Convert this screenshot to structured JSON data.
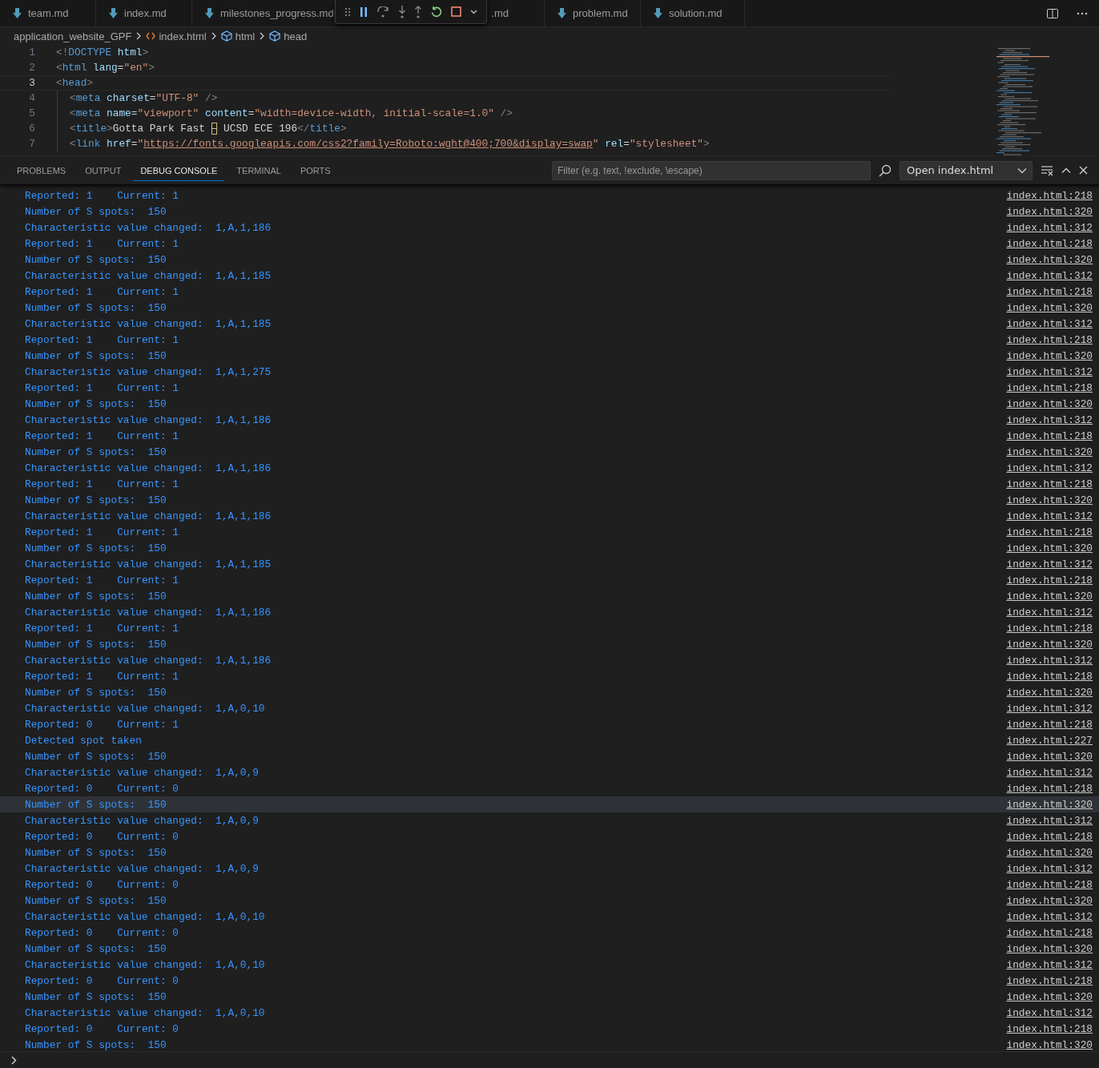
{
  "editor_tabs": [
    {
      "label": "team.md"
    },
    {
      "label": "index.md"
    },
    {
      "label": "milestones_progress.md"
    },
    {
      "label": ".md"
    },
    {
      "label": "problem.md"
    },
    {
      "label": "solution.md"
    }
  ],
  "breadcrumb": [
    {
      "label": "application_website_GPF",
      "kind": "folder"
    },
    {
      "label": "index.html",
      "kind": "file"
    },
    {
      "label": "html",
      "kind": "element"
    },
    {
      "label": "head",
      "kind": "element"
    }
  ],
  "code_lines": [
    {
      "number": "1",
      "selected": false,
      "indented": false,
      "tokens": [
        {
          "text": "<!",
          "kind": "punct"
        },
        {
          "text": "DOCTYPE",
          "kind": "tag"
        },
        {
          "text": " html",
          "kind": "attr"
        },
        {
          "text": ">",
          "kind": "punct"
        }
      ]
    },
    {
      "number": "2",
      "selected": false,
      "indented": false,
      "tokens": [
        {
          "text": "<",
          "kind": "punct"
        },
        {
          "text": "html",
          "kind": "tag"
        },
        {
          "text": " lang",
          "kind": "attr"
        },
        {
          "text": "=",
          "kind": "text"
        },
        {
          "text": "\"en\"",
          "kind": "str"
        },
        {
          "text": ">",
          "kind": "punct"
        }
      ]
    },
    {
      "number": "3",
      "selected": true,
      "indented": false,
      "tokens": [
        {
          "text": "<",
          "kind": "punct"
        },
        {
          "text": "head",
          "kind": "tag"
        },
        {
          "text": ">",
          "kind": "punct"
        }
      ]
    },
    {
      "number": "4",
      "selected": false,
      "indented": true,
      "tokens": [
        {
          "text": "<",
          "kind": "punct"
        },
        {
          "text": "meta",
          "kind": "tag"
        },
        {
          "text": " charset",
          "kind": "attr"
        },
        {
          "text": "=",
          "kind": "text"
        },
        {
          "text": "\"UTF-8\"",
          "kind": "str"
        },
        {
          "text": " />",
          "kind": "punct"
        }
      ]
    },
    {
      "number": "5",
      "selected": false,
      "indented": true,
      "tokens": [
        {
          "text": "<",
          "kind": "punct"
        },
        {
          "text": "meta",
          "kind": "tag"
        },
        {
          "text": " name",
          "kind": "attr"
        },
        {
          "text": "=",
          "kind": "text"
        },
        {
          "text": "\"viewport\"",
          "kind": "str"
        },
        {
          "text": " content",
          "kind": "attr"
        },
        {
          "text": "=",
          "kind": "text"
        },
        {
          "text": "\"width=device-width, initial-scale=1.0\"",
          "kind": "str"
        },
        {
          "text": " />",
          "kind": "punct"
        }
      ]
    },
    {
      "number": "6",
      "selected": false,
      "indented": true,
      "tokens": [
        {
          "text": "<",
          "kind": "punct"
        },
        {
          "text": "title",
          "kind": "tag"
        },
        {
          "text": ">",
          "kind": "punct"
        },
        {
          "text": "Gotta Park Fast ",
          "kind": "text"
        },
        {
          "text": "–",
          "kind": "flagged"
        },
        {
          "text": " UCSD ECE 196",
          "kind": "text"
        },
        {
          "text": "</",
          "kind": "punct"
        },
        {
          "text": "title",
          "kind": "tag"
        },
        {
          "text": ">",
          "kind": "punct"
        }
      ]
    },
    {
      "number": "7",
      "selected": false,
      "indented": true,
      "tokens": [
        {
          "text": "<",
          "kind": "punct"
        },
        {
          "text": "link",
          "kind": "tag"
        },
        {
          "text": " href",
          "kind": "attr"
        },
        {
          "text": "=",
          "kind": "text"
        },
        {
          "text": "\"",
          "kind": "str"
        },
        {
          "text": "https://fonts.googleapis.com/css2?family=Roboto:wght@400;700&display=swap",
          "kind": "link"
        },
        {
          "text": "\"",
          "kind": "str"
        },
        {
          "text": " rel",
          "kind": "attr"
        },
        {
          "text": "=",
          "kind": "text"
        },
        {
          "text": "\"stylesheet\"",
          "kind": "str"
        },
        {
          "text": ">",
          "kind": "punct"
        }
      ]
    }
  ],
  "panel_tabs": [
    {
      "label": "PROBLEMS",
      "selected": false
    },
    {
      "label": "OUTPUT",
      "selected": false
    },
    {
      "label": "DEBUG CONSOLE",
      "selected": true
    },
    {
      "label": "TERMINAL",
      "selected": false
    },
    {
      "label": "PORTS",
      "selected": false
    }
  ],
  "filter": {
    "placeholder": "Filter (e.g. text, !exclude, \\escape)"
  },
  "session_select": {
    "value": "Open index.html"
  },
  "console_rows": [
    {
      "text": "Reported: 1    Current: 1",
      "source": "index.html:218",
      "selected": false
    },
    {
      "text": "Number of S spots:  150",
      "source": "index.html:320",
      "selected": false
    },
    {
      "text": "Characteristic value changed:  1,A,1,186",
      "source": "index.html:312",
      "selected": false
    },
    {
      "text": "Reported: 1    Current: 1",
      "source": "index.html:218",
      "selected": false
    },
    {
      "text": "Number of S spots:  150",
      "source": "index.html:320",
      "selected": false
    },
    {
      "text": "Characteristic value changed:  1,A,1,185",
      "source": "index.html:312",
      "selected": false
    },
    {
      "text": "Reported: 1    Current: 1",
      "source": "index.html:218",
      "selected": false
    },
    {
      "text": "Number of S spots:  150",
      "source": "index.html:320",
      "selected": false
    },
    {
      "text": "Characteristic value changed:  1,A,1,185",
      "source": "index.html:312",
      "selected": false
    },
    {
      "text": "Reported: 1    Current: 1",
      "source": "index.html:218",
      "selected": false
    },
    {
      "text": "Number of S spots:  150",
      "source": "index.html:320",
      "selected": false
    },
    {
      "text": "Characteristic value changed:  1,A,1,275",
      "source": "index.html:312",
      "selected": false
    },
    {
      "text": "Reported: 1    Current: 1",
      "source": "index.html:218",
      "selected": false
    },
    {
      "text": "Number of S spots:  150",
      "source": "index.html:320",
      "selected": false
    },
    {
      "text": "Characteristic value changed:  1,A,1,186",
      "source": "index.html:312",
      "selected": false
    },
    {
      "text": "Reported: 1    Current: 1",
      "source": "index.html:218",
      "selected": false
    },
    {
      "text": "Number of S spots:  150",
      "source": "index.html:320",
      "selected": false
    },
    {
      "text": "Characteristic value changed:  1,A,1,186",
      "source": "index.html:312",
      "selected": false
    },
    {
      "text": "Reported: 1    Current: 1",
      "source": "index.html:218",
      "selected": false
    },
    {
      "text": "Number of S spots:  150",
      "source": "index.html:320",
      "selected": false
    },
    {
      "text": "Characteristic value changed:  1,A,1,186",
      "source": "index.html:312",
      "selected": false
    },
    {
      "text": "Reported: 1    Current: 1",
      "source": "index.html:218",
      "selected": false
    },
    {
      "text": "Number of S spots:  150",
      "source": "index.html:320",
      "selected": false
    },
    {
      "text": "Characteristic value changed:  1,A,1,185",
      "source": "index.html:312",
      "selected": false
    },
    {
      "text": "Reported: 1    Current: 1",
      "source": "index.html:218",
      "selected": false
    },
    {
      "text": "Number of S spots:  150",
      "source": "index.html:320",
      "selected": false
    },
    {
      "text": "Characteristic value changed:  1,A,1,186",
      "source": "index.html:312",
      "selected": false
    },
    {
      "text": "Reported: 1    Current: 1",
      "source": "index.html:218",
      "selected": false
    },
    {
      "text": "Number of S spots:  150",
      "source": "index.html:320",
      "selected": false
    },
    {
      "text": "Characteristic value changed:  1,A,1,186",
      "source": "index.html:312",
      "selected": false
    },
    {
      "text": "Reported: 1    Current: 1",
      "source": "index.html:218",
      "selected": false
    },
    {
      "text": "Number of S spots:  150",
      "source": "index.html:320",
      "selected": false
    },
    {
      "text": "Characteristic value changed:  1,A,0,10",
      "source": "index.html:312",
      "selected": false
    },
    {
      "text": "Reported: 0    Current: 1",
      "source": "index.html:218",
      "selected": false
    },
    {
      "text": "Detected spot taken",
      "source": "index.html:227",
      "selected": false
    },
    {
      "text": "Number of S spots:  150",
      "source": "index.html:320",
      "selected": false
    },
    {
      "text": "Characteristic value changed:  1,A,0,9",
      "source": "index.html:312",
      "selected": false
    },
    {
      "text": "Reported: 0    Current: 0",
      "source": "index.html:218",
      "selected": false
    },
    {
      "text": "Number of S spots:  150",
      "source": "index.html:320",
      "selected": true
    },
    {
      "text": "Characteristic value changed:  1,A,0,9",
      "source": "index.html:312",
      "selected": false
    },
    {
      "text": "Reported: 0    Current: 0",
      "source": "index.html:218",
      "selected": false
    },
    {
      "text": "Number of S spots:  150",
      "source": "index.html:320",
      "selected": false
    },
    {
      "text": "Characteristic value changed:  1,A,0,9",
      "source": "index.html:312",
      "selected": false
    },
    {
      "text": "Reported: 0    Current: 0",
      "source": "index.html:218",
      "selected": false
    },
    {
      "text": "Number of S spots:  150",
      "source": "index.html:320",
      "selected": false
    },
    {
      "text": "Characteristic value changed:  1,A,0,10",
      "source": "index.html:312",
      "selected": false
    },
    {
      "text": "Reported: 0    Current: 0",
      "source": "index.html:218",
      "selected": false
    },
    {
      "text": "Number of S spots:  150",
      "source": "index.html:320",
      "selected": false
    },
    {
      "text": "Characteristic value changed:  1,A,0,10",
      "source": "index.html:312",
      "selected": false
    },
    {
      "text": "Reported: 0    Current: 0",
      "source": "index.html:218",
      "selected": false
    },
    {
      "text": "Number of S spots:  150",
      "source": "index.html:320",
      "selected": false
    },
    {
      "text": "Characteristic value changed:  1,A,0,10",
      "source": "index.html:312",
      "selected": false
    },
    {
      "text": "Reported: 0    Current: 0",
      "source": "index.html:218",
      "selected": false
    },
    {
      "text": "Number of S spots:  150",
      "source": "index.html:320",
      "selected": false
    }
  ]
}
